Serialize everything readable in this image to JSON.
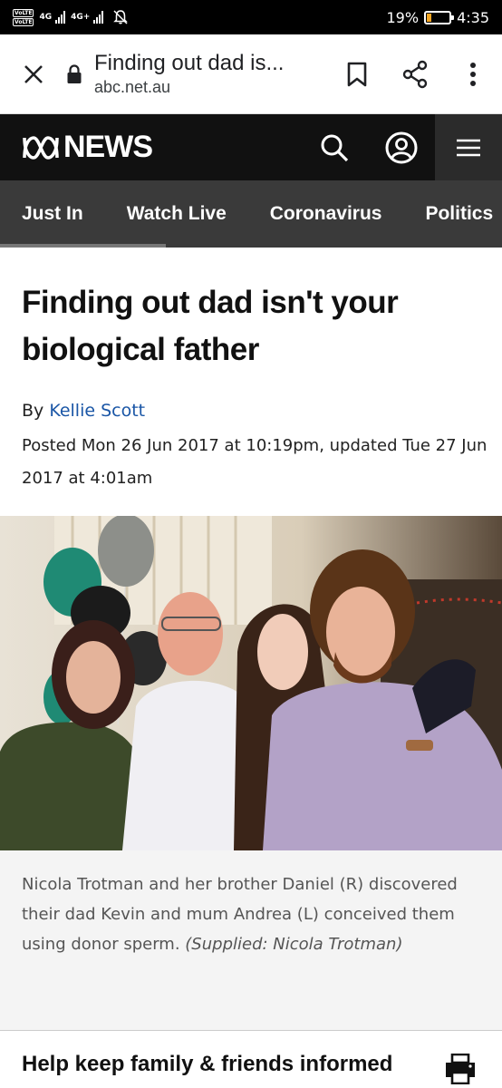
{
  "status_bar": {
    "volte_1": "VoLTE",
    "volte_2": "VoLTE",
    "network_1": "4G",
    "network_2": "4G+",
    "battery_percent": "19%",
    "battery_level": 0.19,
    "time": "4:35",
    "battery_color": "#f5a623"
  },
  "browser": {
    "page_title": "Finding out dad is...",
    "domain": "abc.net.au",
    "icons": [
      "close-icon",
      "lock-icon",
      "bookmark-icon",
      "share-icon",
      "more-vert-icon"
    ]
  },
  "header": {
    "logo_text": "NEWS",
    "icons": [
      "search-icon",
      "account-icon",
      "menu-icon"
    ]
  },
  "nav": {
    "items": [
      "Just In",
      "Watch Live",
      "Coronavirus",
      "Politics"
    ]
  },
  "article": {
    "headline": "Finding out dad isn't your biological father",
    "by_prefix": "By",
    "author": "Kellie Scott",
    "posted": "Posted Mon 26 Jun 2017 at 10:19pm, updated Tue 27 Jun 2017 at 4:01am"
  },
  "photo": {
    "caption": "Nicola Trotman and her brother Daniel (R) discovered their dad Kevin and mum Andrea (L) conceived them using donor sperm.",
    "credit": "(Supplied: Nicola Trotman)"
  },
  "help_section": {
    "heading": "Help keep family & friends informed",
    "icon": "print-icon"
  },
  "colors": {
    "link": "#1a56a6",
    "header_bg": "#111111",
    "nav_bg": "#3a3a3a"
  }
}
